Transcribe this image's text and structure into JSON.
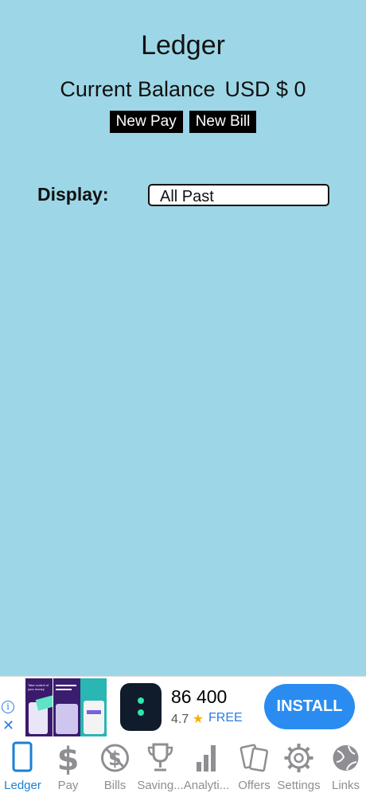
{
  "header": {
    "title": "Ledger",
    "balance_label": "Current Balance",
    "balance_value": "USD $ 0",
    "new_pay_label": "New Pay",
    "new_bill_label": "New Bill"
  },
  "filter": {
    "label": "Display:",
    "selected": "All Past"
  },
  "ad": {
    "info_icon": "info-icon",
    "close_icon": "close-icon",
    "app_name": "86 400",
    "rating": "4.7",
    "price": "FREE",
    "install_label": "INSTALL",
    "screenshot_text": "Take control of your money"
  },
  "tabs": [
    {
      "label": "Ledger",
      "icon": "phone-icon",
      "active": true
    },
    {
      "label": "Pay",
      "icon": "dollar-icon",
      "active": false
    },
    {
      "label": "Bills",
      "icon": "no-dollar-icon",
      "active": false
    },
    {
      "label": "Saving...",
      "icon": "trophy-icon",
      "active": false
    },
    {
      "label": "Analyti...",
      "icon": "bar-chart-icon",
      "active": false
    },
    {
      "label": "Offers",
      "icon": "cards-icon",
      "active": false
    },
    {
      "label": "Settings",
      "icon": "gear-icon",
      "active": false
    },
    {
      "label": "Links",
      "icon": "globe-icon",
      "active": false
    }
  ],
  "colors": {
    "background": "#9dd7e7",
    "active_tab": "#1a7fd6",
    "inactive_tab": "#8e8e93",
    "install_button": "#2a8cf0"
  }
}
